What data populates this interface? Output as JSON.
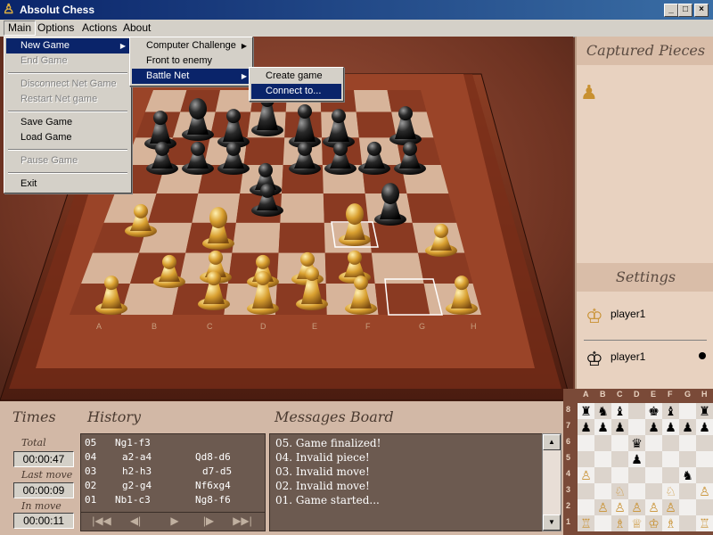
{
  "window": {
    "title": "Absolut Chess",
    "min": "_",
    "max": "□",
    "close": "×"
  },
  "menubar": [
    "Main",
    "Options",
    "Actions",
    "About"
  ],
  "main_menu": {
    "items": [
      {
        "label": "New Game",
        "enabled": true,
        "submenu": true
      },
      {
        "label": "End Game",
        "enabled": false
      },
      {
        "label": "Disconnect Net Game",
        "enabled": false
      },
      {
        "label": "Restart Net game",
        "enabled": false
      },
      {
        "label": "Save Game",
        "enabled": true
      },
      {
        "label": "Load Game",
        "enabled": true
      },
      {
        "label": "Pause Game",
        "enabled": false
      },
      {
        "label": "Exit",
        "enabled": true
      }
    ]
  },
  "new_game_menu": {
    "items": [
      "Computer Challenge",
      "Front to enemy",
      "Battle Net"
    ]
  },
  "battle_net_menu": {
    "items": [
      "Create game",
      "Connect to..."
    ]
  },
  "captured_pieces": {
    "title": "Captured Pieces",
    "pieces": [
      "♟"
    ]
  },
  "settings": {
    "title": "Settings",
    "players": [
      {
        "name": "player1",
        "icon": "white-king-icon"
      },
      {
        "name": "player1",
        "icon": "black-king-icon"
      }
    ]
  },
  "times": {
    "title": "Times",
    "total_label": "Total",
    "total": "00:00:47",
    "last_label": "Last move",
    "last": "00:00:09",
    "inmove_label": "In move",
    "inmove": "00:00:11"
  },
  "history": {
    "title": "History",
    "rows": [
      {
        "n": "05",
        "w": "Ng1-f3",
        "b": ""
      },
      {
        "n": "04",
        "w": "a2-a4",
        "b": "Qd8-d6"
      },
      {
        "n": "03",
        "w": "h2-h3",
        "b": "d7-d5"
      },
      {
        "n": "02",
        "w": "g2-g4",
        "b": "Nf6xg4"
      },
      {
        "n": "01",
        "w": "Nb1-c3",
        "b": "Ng8-f6"
      }
    ]
  },
  "messages": {
    "title": "Messages Board",
    "rows": [
      "05. Game finalized!",
      "04. Invalid piece!",
      "03. Invalid move!",
      "02. Invalid move!",
      "01. Game started..."
    ]
  },
  "board_files": [
    "A",
    "B",
    "C",
    "D",
    "E",
    "F",
    "G",
    "H"
  ],
  "board_ranks": [
    "8",
    "7",
    "6",
    "5",
    "4",
    "3",
    "2",
    "1"
  ],
  "minimap": {
    "rows": [
      [
        "♜",
        "♞",
        "♝",
        "",
        "♚",
        "♝",
        "",
        "♜"
      ],
      [
        "♟",
        "♟",
        "♟",
        "",
        "♟",
        "♟",
        "♟",
        "♟"
      ],
      [
        "",
        "",
        "",
        "♛",
        "",
        "",
        "",
        ""
      ],
      [
        "",
        "",
        "",
        "♟",
        "",
        "",
        "",
        ""
      ],
      [
        "♙",
        "",
        "",
        "",
        "",
        "",
        "♞",
        ""
      ],
      [
        "",
        "",
        "♘",
        "",
        "",
        "♘",
        "",
        "♙"
      ],
      [
        "",
        "♙",
        "♙",
        "♙",
        "♙",
        "♙",
        "",
        ""
      ],
      [
        "♖",
        "",
        "♗",
        "♕",
        "♔",
        "♗",
        "",
        "♖"
      ]
    ]
  },
  "colors": {
    "accent": "#0a246a",
    "panel": "#e8d2c0",
    "wood": "#7a3a24"
  }
}
